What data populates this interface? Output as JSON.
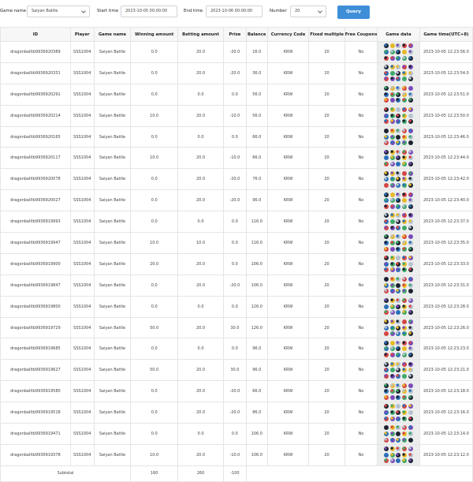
{
  "filters": {
    "game_name_label": "Game name",
    "game_name_value": "Saiyan Battle",
    "start_time_label": "Start time",
    "start_time_value": "2023-10-05 00:00:00",
    "end_time_label": "End time",
    "end_time_value": "2023-10-06 00:00:00",
    "number_label": "Number",
    "number_value": "20",
    "query_label": "Query"
  },
  "table": {
    "headers": [
      "ID",
      "Player",
      "Game name",
      "Winning amount",
      "Betting amount",
      "Prize",
      "Balance",
      "Currency Code",
      "Fixed multiple",
      "Free Coupons",
      "Game data",
      "Game time(UTC+8)"
    ],
    "rows": [
      {
        "id": "dragonballtb9936920389",
        "player": "SSS1004",
        "game": "Saiyan Battle",
        "win": "0.0",
        "bet": "20.0",
        "prize": "-20.0",
        "balance": "16.0",
        "currency": "KRW",
        "multiple": "20",
        "free": "No",
        "time": "2023-10-05 12:23:56.0"
      },
      {
        "id": "dragonballtb9936920331",
        "player": "SSS1004",
        "game": "Saiyan Battle",
        "win": "0.0",
        "bet": "20.0",
        "prize": "-20.0",
        "balance": "36.0",
        "currency": "KRW",
        "multiple": "20",
        "free": "No",
        "time": "2023-10-05 12:23:54.0"
      },
      {
        "id": "dragonballtb9936920291",
        "player": "SSS1004",
        "game": "Saiyan Battle",
        "win": "0.0",
        "bet": "0.0",
        "prize": "0.0",
        "balance": "56.0",
        "currency": "KRW",
        "multiple": "20",
        "free": "No",
        "time": "2023-10-05 12:23:51.0"
      },
      {
        "id": "dragonballtb9936920214",
        "player": "SSS1004",
        "game": "Saiyan Battle",
        "win": "10.0",
        "bet": "20.0",
        "prize": "-10.0",
        "balance": "56.0",
        "currency": "KRW",
        "multiple": "20",
        "free": "No",
        "time": "2023-10-05 12:23:50.0"
      },
      {
        "id": "dragonballtb9936920165",
        "player": "SSS1004",
        "game": "Saiyan Battle",
        "win": "0.0",
        "bet": "0.0",
        "prize": "0.0",
        "balance": "66.0",
        "currency": "KRW",
        "multiple": "20",
        "free": "No",
        "time": "2023-10-05 12:23:46.0"
      },
      {
        "id": "dragonballtb9936920117",
        "player": "SSS1004",
        "game": "Saiyan Battle",
        "win": "10.0",
        "bet": "20.0",
        "prize": "-10.0",
        "balance": "66.0",
        "currency": "KRW",
        "multiple": "20",
        "free": "No",
        "time": "2023-10-05 12:23:44.0"
      },
      {
        "id": "dragonballtb9936920078",
        "player": "SSS1004",
        "game": "Saiyan Battle",
        "win": "0.0",
        "bet": "20.0",
        "prize": "-20.0",
        "balance": "76.0",
        "currency": "KRW",
        "multiple": "20",
        "free": "No",
        "time": "2023-10-05 12:23:42.0"
      },
      {
        "id": "dragonballtb9936920027",
        "player": "SSS1004",
        "game": "Saiyan Battle",
        "win": "0.0",
        "bet": "20.0",
        "prize": "-20.0",
        "balance": "96.0",
        "currency": "KRW",
        "multiple": "20",
        "free": "No",
        "time": "2023-10-05 12:23:40.0"
      },
      {
        "id": "dragonballtb9936919993",
        "player": "SSS1004",
        "game": "Saiyan Battle",
        "win": "0.0",
        "bet": "0.0",
        "prize": "0.0",
        "balance": "116.0",
        "currency": "KRW",
        "multiple": "20",
        "free": "No",
        "time": "2023-10-05 12:23:37.0"
      },
      {
        "id": "dragonballtb9936919947",
        "player": "SSS1004",
        "game": "Saiyan Battle",
        "win": "10.0",
        "bet": "10.0",
        "prize": "0.0",
        "balance": "116.0",
        "currency": "KRW",
        "multiple": "20",
        "free": "No",
        "time": "2023-10-05 12:23:35.0"
      },
      {
        "id": "dragonballtb9936919900",
        "player": "SSS1004",
        "game": "Saiyan Battle",
        "win": "20.0",
        "bet": "20.0",
        "prize": "0.0",
        "balance": "106.0",
        "currency": "KRW",
        "multiple": "20",
        "free": "No",
        "time": "2023-10-05 12:23:33.0"
      },
      {
        "id": "dragonballtb9936919847",
        "player": "SSS1004",
        "game": "Saiyan Battle",
        "win": "0.0",
        "bet": "20.0",
        "prize": "-20.0",
        "balance": "106.0",
        "currency": "KRW",
        "multiple": "20",
        "free": "No",
        "time": "2023-10-05 12:23:31.0"
      },
      {
        "id": "dragonballtb9936919800",
        "player": "SSS1004",
        "game": "Saiyan Battle",
        "win": "0.0",
        "bet": "0.0",
        "prize": "0.0",
        "balance": "126.0",
        "currency": "KRW",
        "multiple": "20",
        "free": "No",
        "time": "2023-10-05 12:23:28.0"
      },
      {
        "id": "dragonballtb9936919729",
        "player": "SSS1004",
        "game": "Saiyan Battle",
        "win": "50.0",
        "bet": "20.0",
        "prize": "30.0",
        "balance": "126.0",
        "currency": "KRW",
        "multiple": "20",
        "free": "No",
        "time": "2023-10-05 12:23:26.0"
      },
      {
        "id": "dragonballtb9936919685",
        "player": "SSS1004",
        "game": "Saiyan Battle",
        "win": "0.0",
        "bet": "0.0",
        "prize": "0.0",
        "balance": "96.0",
        "currency": "KRW",
        "multiple": "20",
        "free": "No",
        "time": "2023-10-05 12:23:23.0"
      },
      {
        "id": "dragonballtb9936919627",
        "player": "SSS1004",
        "game": "Saiyan Battle",
        "win": "50.0",
        "bet": "20.0",
        "prize": "30.0",
        "balance": "96.0",
        "currency": "KRW",
        "multiple": "20",
        "free": "No",
        "time": "2023-10-05 12:23:21.0"
      },
      {
        "id": "dragonballtb9936919580",
        "player": "SSS1004",
        "game": "Saiyan Battle",
        "win": "0.0",
        "bet": "20.0",
        "prize": "-20.0",
        "balance": "66.0",
        "currency": "KRW",
        "multiple": "20",
        "free": "No",
        "time": "2023-10-05 12:23:18.0"
      },
      {
        "id": "dragonballtb9936919518",
        "player": "SSS1004",
        "game": "Saiyan Battle",
        "win": "0.0",
        "bet": "20.0",
        "prize": "-20.0",
        "balance": "86.0",
        "currency": "KRW",
        "multiple": "20",
        "free": "No",
        "time": "2023-10-05 12:23:16.0"
      },
      {
        "id": "dragonballtb9936919471",
        "player": "SSS1004",
        "game": "Saiyan Battle",
        "win": "0.0",
        "bet": "0.0",
        "prize": "0.0",
        "balance": "106.0",
        "currency": "KRW",
        "multiple": "20",
        "free": "No",
        "time": "2023-10-05 12:23:14.0"
      },
      {
        "id": "dragonballtb9936919378",
        "player": "SSS1004",
        "game": "Saiyan Battle",
        "win": "10.0",
        "bet": "20.0",
        "prize": "-10.0",
        "balance": "106.0",
        "currency": "KRW",
        "multiple": "20",
        "free": "No",
        "time": "2023-10-05 12:23:12.0"
      }
    ],
    "subtotal": {
      "label": "Subtotal",
      "win": "160",
      "bet": "260",
      "prize": "-100"
    }
  },
  "colors": {
    "query_button": "#3e8fd8",
    "game_data_cell": "#eceeed",
    "symbols": [
      "#1c2230",
      "#2a6fb8",
      "#d64545",
      "#e8b928",
      "#3fa868",
      "#7b4bb8",
      "#b6c2d0"
    ]
  }
}
